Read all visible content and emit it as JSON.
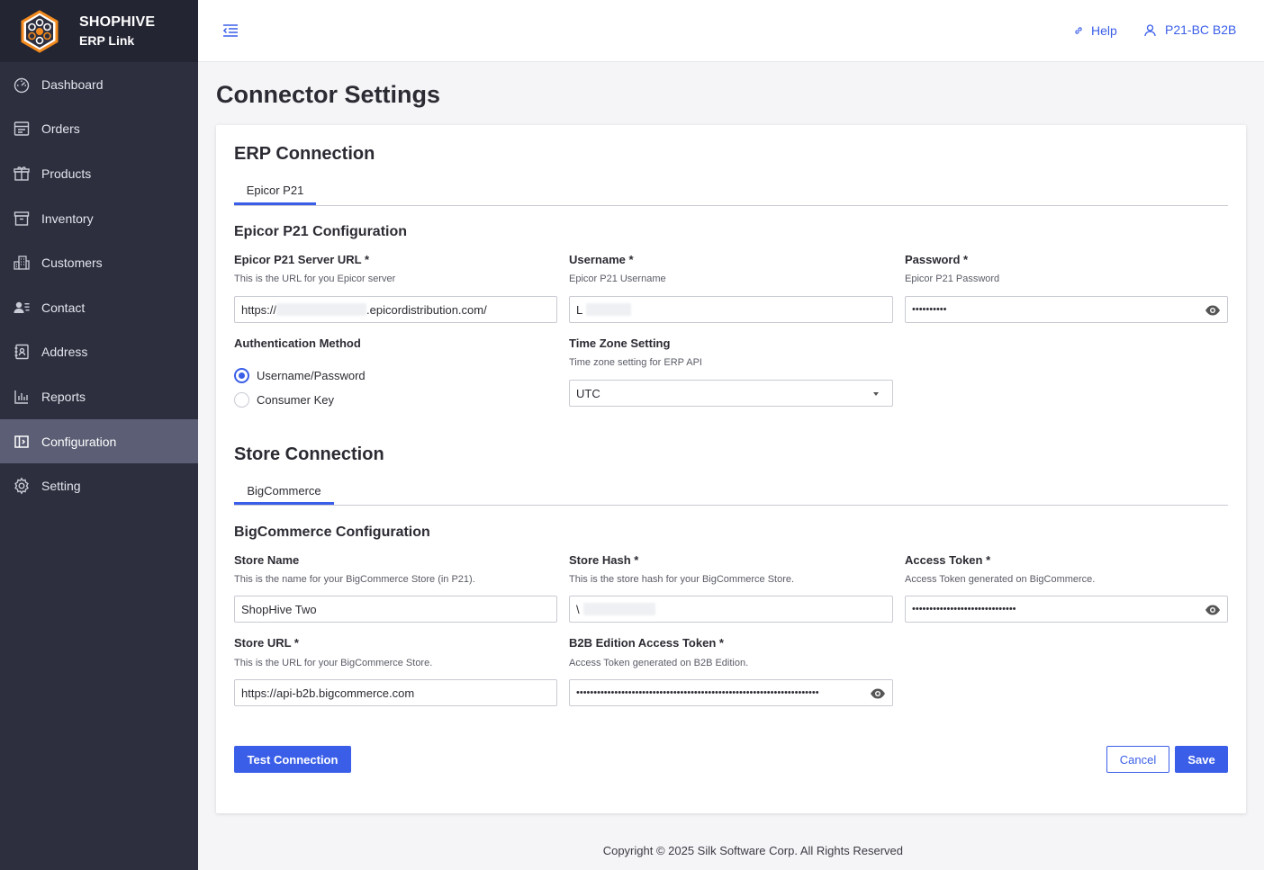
{
  "brand": {
    "name": "SHOPHIVE",
    "sub": "ERP Link"
  },
  "sidebar": {
    "items": [
      {
        "label": "Dashboard",
        "icon": "dashboard-icon"
      },
      {
        "label": "Orders",
        "icon": "orders-icon"
      },
      {
        "label": "Products",
        "icon": "products-icon"
      },
      {
        "label": "Inventory",
        "icon": "inventory-icon"
      },
      {
        "label": "Customers",
        "icon": "customers-icon"
      },
      {
        "label": "Contact",
        "icon": "contact-icon"
      },
      {
        "label": "Address",
        "icon": "address-icon"
      },
      {
        "label": "Reports",
        "icon": "reports-icon"
      },
      {
        "label": "Configuration",
        "icon": "configuration-icon",
        "active": true
      },
      {
        "label": "Setting",
        "icon": "setting-icon"
      }
    ]
  },
  "header": {
    "help_label": "Help",
    "user_label": "P21-BC B2B"
  },
  "page": {
    "title": "Connector Settings"
  },
  "erp": {
    "section_title": "ERP Connection",
    "tab_label": "Epicor P21",
    "config_title": "Epicor P21 Configuration",
    "server_url": {
      "label": "Epicor P21 Server URL *",
      "help": "This is the URL for you Epicor server",
      "value_prefix": "https://",
      "value_suffix": ".epicordistribution.com/"
    },
    "username": {
      "label": "Username *",
      "help": "Epicor P21 Username",
      "value": "L"
    },
    "password": {
      "label": "Password *",
      "help": "Epicor P21 Password",
      "value": "••••••••••"
    },
    "auth": {
      "label": "Authentication Method",
      "options": [
        "Username/Password",
        "Consumer Key"
      ],
      "selected": "Username/Password"
    },
    "timezone": {
      "label": "Time Zone Setting",
      "help": "Time zone setting for ERP API",
      "value": "UTC"
    }
  },
  "store": {
    "section_title": "Store Connection",
    "tab_label": "BigCommerce",
    "config_title": "BigCommerce Configuration",
    "store_name": {
      "label": "Store Name",
      "help": "This is the name for your BigCommerce Store (in P21).",
      "value": "ShopHive Two"
    },
    "store_hash": {
      "label": "Store Hash *",
      "help": "This is the store hash for your BigCommerce Store.",
      "value": "\\"
    },
    "access_token": {
      "label": "Access Token *",
      "help": "Access Token generated on BigCommerce.",
      "value": "••••••••••••••••••••••••••••••"
    },
    "store_url": {
      "label": "Store URL *",
      "help": "This is the URL for your BigCommerce Store.",
      "value": "https://api-b2b.bigcommerce.com"
    },
    "b2b_token": {
      "label": "B2B Edition Access Token *",
      "help": "Access Token generated on B2B Edition.",
      "value": "••••••••••••••••••••••••••••••••••••••••••••••••••••••••••••••••••••••"
    }
  },
  "actions": {
    "test_label": "Test Connection",
    "cancel_label": "Cancel",
    "save_label": "Save"
  },
  "footer": {
    "text": "Copyright © 2025 Silk Software Corp. All Rights Reserved"
  },
  "colors": {
    "accent": "#3a5ee8",
    "sidebar": "#2d2f3e",
    "sidebar_active": "#5b5e74"
  }
}
